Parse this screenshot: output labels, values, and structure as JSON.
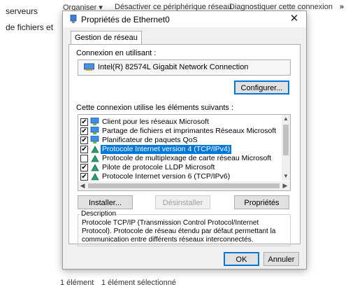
{
  "background": {
    "nav_items": [
      "serveurs",
      "de fichiers et"
    ],
    "toolbar": {
      "organize": "Organiser ▾",
      "disable": "Désactiver ce périphérique réseau",
      "diagnose": "Diagnostiquer cette connexion",
      "more": "»"
    },
    "status": {
      "count": "1 élément",
      "selected": "1 élément sélectionné"
    }
  },
  "dialog": {
    "title": "Propriétés de Ethernet0",
    "close": "✕",
    "tab": "Gestion de réseau",
    "connect_using_label": "Connexion en utilisant :",
    "adapter": "Intel(R) 82574L Gigabit Network Connection",
    "configure_button": "Configurer...",
    "items_label": "Cette connexion utilise les éléments suivants :",
    "items": [
      {
        "label": "Client pour les réseaux Microsoft",
        "checked": true,
        "icon": "network-client-icon",
        "selected": false
      },
      {
        "label": "Partage de fichiers et imprimantes Réseaux Microsoft",
        "checked": true,
        "icon": "network-service-icon",
        "selected": false
      },
      {
        "label": "Planificateur de paquets QoS",
        "checked": true,
        "icon": "network-service-icon",
        "selected": false
      },
      {
        "label": "Protocole Internet version 4 (TCP/IPv4)",
        "checked": true,
        "icon": "protocol-icon",
        "selected": true
      },
      {
        "label": "Protocole de multiplexage de carte réseau Microsoft",
        "checked": false,
        "icon": "protocol-icon",
        "selected": false
      },
      {
        "label": "Pilote de protocole LLDP Microsoft",
        "checked": true,
        "icon": "protocol-icon",
        "selected": false
      },
      {
        "label": "Protocole Internet version 6 (TCP/IPv6)",
        "checked": true,
        "icon": "protocol-icon",
        "selected": false
      }
    ],
    "install_button": "Installer...",
    "uninstall_button": "Désinstaller",
    "properties_button": "Propriétés",
    "description_title": "Description",
    "description_text": "Protocole TCP/IP (Transmission Control Protocol/Internet Protocol). Protocole de réseau étendu par défaut permettant la communication entre différents réseaux interconnectés.",
    "ok_button": "OK",
    "cancel_button": "Annuler"
  },
  "colors": {
    "accent": "#0078d7",
    "dialog_bg": "#f0f0f0",
    "button_bg": "#e1e1e1"
  }
}
